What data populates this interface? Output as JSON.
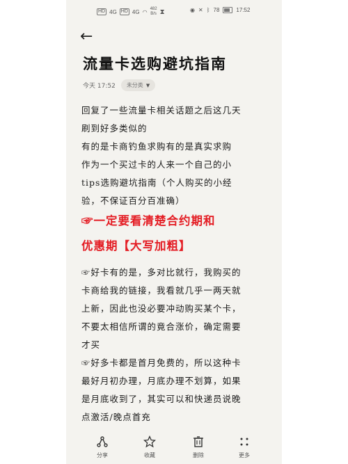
{
  "status": {
    "left_signals": [
      "HD",
      "4G",
      "HD",
      "4G"
    ],
    "speed_value": "482",
    "speed_unit": "B/s",
    "battery": "78",
    "time": "17:52"
  },
  "header": {
    "back_icon": "arrow-left-icon",
    "title": "流量卡选购避坑指南"
  },
  "meta": {
    "time": "今天 17:52",
    "category": "未分类"
  },
  "content": {
    "line1": "回复了一些流量卡相关话题之后这几天",
    "line2": "刷到好多类似的",
    "line3": "有的是卡商钓鱼求购有的是真实求购",
    "line4": "作为一个买过卡的人来一个自己的小",
    "line5": "tips选购避坑指南（个人购买的小经",
    "line6": "验，不保证百分百准确）",
    "red1": "☞一定要看清楚合约期和",
    "red2": "优惠期【大写加粗】",
    "p2_1": "☞好卡有的是，多对比就行，我购买的",
    "p2_2": "卡商给我的链接，我看就几乎一两天就",
    "p2_3": "上新，因此也没必要冲动购买某个卡，",
    "p2_4": "不要太相信所谓的竟合涨价，确定需要",
    "p2_5": "才买",
    "p3_1": "☞好多卡都是首月免费的，所以这种卡",
    "p3_2": "最好月初办理，月底办理不划算，如果",
    "p3_3": "是月底收到了，其实可以和快递员说晚",
    "p3_4": "点激活/晚点首充"
  },
  "bottombar": {
    "share": "分享",
    "favorite": "收藏",
    "delete": "删除",
    "more": "更多"
  }
}
